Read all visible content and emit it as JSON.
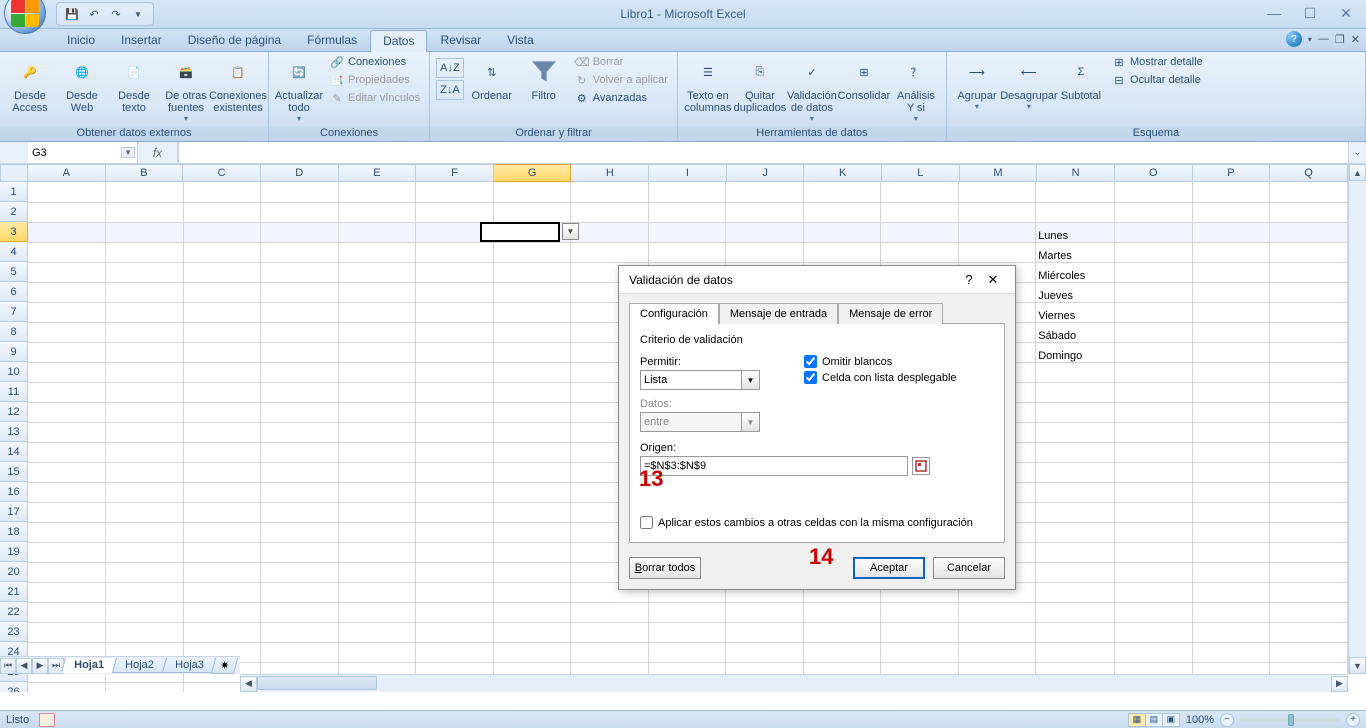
{
  "window": {
    "title": "Libro1 - Microsoft Excel",
    "status": "Listo",
    "zoom": "100%"
  },
  "tabs": {
    "inicio": "Inicio",
    "insertar": "Insertar",
    "diseno": "Diseño de página",
    "formulas": "Fórmulas",
    "datos": "Datos",
    "revisar": "Revisar",
    "vista": "Vista"
  },
  "ribbon": {
    "g1": {
      "label": "Obtener datos externos",
      "access": "Desde\nAccess",
      "web": "Desde\nWeb",
      "texto": "Desde\ntexto",
      "otras": "De otras\nfuentes",
      "existentes": "Conexiones\nexistentes"
    },
    "g2": {
      "label": "Conexiones",
      "actualizar": "Actualizar\ntodo",
      "conex": "Conexiones",
      "prop": "Propiedades",
      "editar": "Editar vínculos"
    },
    "g3": {
      "label": "Ordenar y filtrar",
      "ordenar": "Ordenar",
      "filtro": "Filtro",
      "borrar": "Borrar",
      "volver": "Volver a aplicar",
      "avanz": "Avanzadas"
    },
    "g4": {
      "label": "Herramientas de datos",
      "texto_cols": "Texto en\ncolumnas",
      "quitar": "Quitar\nduplicados",
      "validacion": "Validación\nde datos",
      "consol": "Consolidar",
      "analisis": "Análisis\nY si"
    },
    "g5": {
      "label": "Esquema",
      "agrupar": "Agrupar",
      "desagrupar": "Desagrupar",
      "subtotal": "Subtotal",
      "mostrar": "Mostrar detalle",
      "ocultar": "Ocultar detalle"
    }
  },
  "namebox": "G3",
  "columns": [
    "A",
    "B",
    "C",
    "D",
    "E",
    "F",
    "G",
    "H",
    "I",
    "J",
    "K",
    "L",
    "M",
    "N",
    "O",
    "P",
    "Q"
  ],
  "data_cells": {
    "N3": "Lunes",
    "N4": "Martes",
    "N5": "Miércoles",
    "N6": "Jueves",
    "N7": "Viernes",
    "N8": "Sábado",
    "N9": "Domingo"
  },
  "sheets": {
    "h1": "Hoja1",
    "h2": "Hoja2",
    "h3": "Hoja3"
  },
  "dialog": {
    "title": "Validación de datos",
    "tab_conf": "Configuración",
    "tab_msg": "Mensaje de entrada",
    "tab_err": "Mensaje de error",
    "criterio": "Criterio de validación",
    "permitir": "Permitir:",
    "permitir_val": "Lista",
    "datos": "Datos:",
    "datos_val": "entre",
    "omitir": "Omitir blancos",
    "celda": "Celda con lista desplegable",
    "origen": "Origen:",
    "origen_val": "=$N$3:$N$9",
    "aplicar": "Aplicar estos cambios a otras celdas con la misma configuración",
    "borrar": "Borrar todos",
    "aceptar": "Aceptar",
    "cancelar": "Cancelar"
  },
  "annotations": {
    "n13": "13",
    "n14": "14"
  }
}
